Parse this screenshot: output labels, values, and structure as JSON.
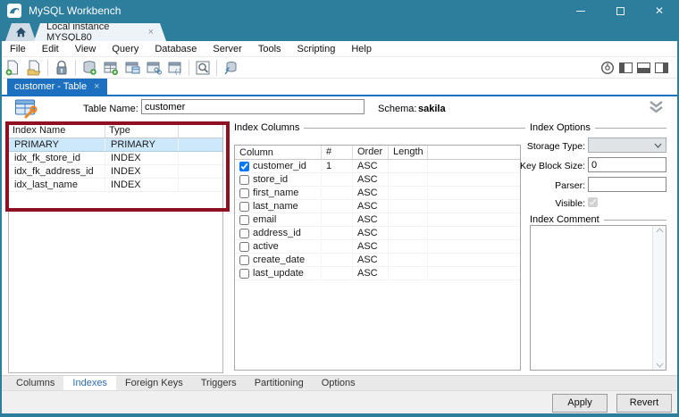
{
  "window": {
    "title": "MySQL Workbench",
    "control_icons": [
      "minimize-icon",
      "maximize-icon",
      "close-icon"
    ]
  },
  "connection_tabs": {
    "home_icon": "home-icon",
    "active_tab": "Local instance MYSQL80",
    "close_glyph": "×"
  },
  "menubar": {
    "items": [
      "File",
      "Edit",
      "View",
      "Query",
      "Database",
      "Server",
      "Tools",
      "Scripting",
      "Help"
    ]
  },
  "toolbar": {
    "left_icons": [
      "new-query-tab-icon",
      "open-script-icon",
      "object-inspector-icon",
      "create-schema-icon",
      "create-table-icon",
      "create-view-icon",
      "create-procedure-icon",
      "create-function-icon",
      "search-data-icon",
      "reconnect-dbms-icon"
    ],
    "right_icons": [
      "performance-dashboard-icon",
      "toggle-left-panel-icon",
      "toggle-bottom-panel-icon",
      "toggle-right-panel-icon"
    ]
  },
  "document_tab": {
    "label": "customer - Table",
    "close_glyph": "×"
  },
  "editor_header": {
    "table_icon": "table-editor-icon",
    "table_name_label": "Table Name:",
    "table_name_value": "customer",
    "schema_label": "Schema:",
    "schema_value": "sakila",
    "collapse_icon": "double-chevron-down-icon"
  },
  "indexes_grid": {
    "headers": [
      "Index Name",
      "Type"
    ],
    "rows": [
      {
        "name": "PRIMARY",
        "type": "PRIMARY",
        "selected": true
      },
      {
        "name": "idx_fk_store_id",
        "type": "INDEX",
        "selected": false
      },
      {
        "name": "idx_fk_address_id",
        "type": "INDEX",
        "selected": false
      },
      {
        "name": "idx_last_name",
        "type": "INDEX",
        "selected": false
      }
    ],
    "annotation": "red-highlight-box"
  },
  "index_columns": {
    "title": "Index Columns",
    "headers": [
      "Column",
      "#",
      "Order",
      "Length"
    ],
    "rows": [
      {
        "column": "customer_id",
        "checked": true,
        "seq": "1",
        "order": "ASC",
        "length": ""
      },
      {
        "column": "store_id",
        "checked": false,
        "seq": "",
        "order": "ASC",
        "length": ""
      },
      {
        "column": "first_name",
        "checked": false,
        "seq": "",
        "order": "ASC",
        "length": ""
      },
      {
        "column": "last_name",
        "checked": false,
        "seq": "",
        "order": "ASC",
        "length": ""
      },
      {
        "column": "email",
        "checked": false,
        "seq": "",
        "order": "ASC",
        "length": ""
      },
      {
        "column": "address_id",
        "checked": false,
        "seq": "",
        "order": "ASC",
        "length": ""
      },
      {
        "column": "active",
        "checked": false,
        "seq": "",
        "order": "ASC",
        "length": ""
      },
      {
        "column": "create_date",
        "checked": false,
        "seq": "",
        "order": "ASC",
        "length": ""
      },
      {
        "column": "last_update",
        "checked": false,
        "seq": "",
        "order": "ASC",
        "length": ""
      }
    ]
  },
  "index_options": {
    "title": "Index Options",
    "storage_type_label": "Storage Type:",
    "storage_type_value": "",
    "key_block_size_label": "Key Block Size:",
    "key_block_size_value": "0",
    "parser_label": "Parser:",
    "parser_value": "",
    "visible_label": "Visible:",
    "visible_checked": true
  },
  "index_comment": {
    "title": "Index Comment",
    "value": ""
  },
  "bottom_tabs": {
    "items": [
      "Columns",
      "Indexes",
      "Foreign Keys",
      "Triggers",
      "Partitioning",
      "Options"
    ],
    "active": "Indexes"
  },
  "footer": {
    "apply_label": "Apply",
    "revert_label": "Revert"
  },
  "colors": {
    "titlebar_teal": "#2d7d9d",
    "active_tab_blue": "#1d70bf",
    "selection_blue": "#cde8fb",
    "annotation_red": "#8e1022"
  }
}
